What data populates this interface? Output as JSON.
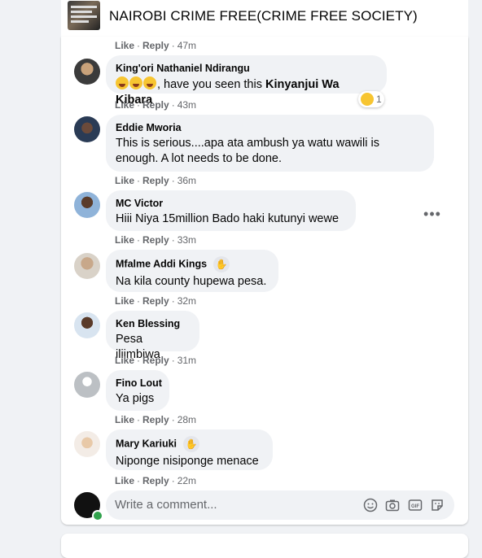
{
  "header": {
    "title": "NAIROBI CRIME FREE(CRIME FREE SOCIETY)"
  },
  "actions": {
    "like": "Like",
    "reply": "Reply",
    "sep": "·"
  },
  "top_meta": {
    "time": "47m"
  },
  "comments": [
    {
      "name": "King'ori Nathaniel Ndirangu",
      "text": ", have you seen this",
      "mention": "Kinyanjui Wa Kibara",
      "time": "43m",
      "reaction_count": "1"
    },
    {
      "name": "Eddie Mworia",
      "text_line1": "This is serious....apa ata ambush ya watu wawili is",
      "text_line2": "enough. A lot needs to be done.",
      "time": "36m"
    },
    {
      "name": "MC Victor",
      "text": "Hiii Niya 15million Bado haki kutunyi wewe",
      "time": "33m"
    },
    {
      "name": "Mfalme Addi Kings",
      "text": "Na kila county hupewa pesa.",
      "time": "32m"
    },
    {
      "name": "Ken Blessing",
      "text": "Pesa iliimbiwa",
      "time": "31m"
    },
    {
      "name": "Fino Lout",
      "text": "Ya pigs",
      "time": "28m"
    },
    {
      "name": "Mary Kariuki",
      "text": "Niponge nisiponge menace",
      "time": "22m"
    }
  ],
  "composer": {
    "placeholder": "Write a comment..."
  },
  "colors": {
    "bubble": "#f0f2f5",
    "meta": "#65676b",
    "online": "#31a24c"
  }
}
